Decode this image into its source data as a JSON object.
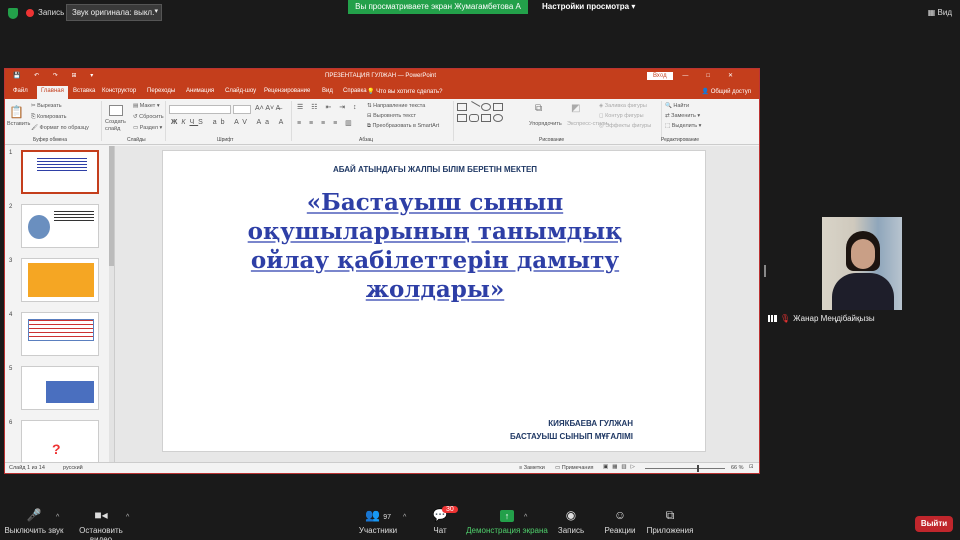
{
  "zoom_top": {
    "record_label": "Запись",
    "audio_label": "Звук оригинала: выкл.",
    "share_banner": "Вы просматриваете экран Жумагамбетова А",
    "view_options": "Настройки просмотра",
    "view_mode": "Вид"
  },
  "ppt": {
    "window_title": "ПРЕЗЕНТАЦИЯ ГУЛЖАН  —  PowerPoint",
    "signin": "Вход",
    "tabs": [
      "Файл",
      "Главная",
      "Вставка",
      "Конструктор",
      "Переходы",
      "Анимация",
      "Слайд-шоу",
      "Рецензирование",
      "Вид",
      "Справка"
    ],
    "tell_me": "Что вы хотите сделать?",
    "share": "Общий доступ",
    "ribbon": {
      "paste": "Вставить",
      "cut": "Вырезать",
      "copy": "Копировать",
      "format_painter": "Формат по образцу",
      "clipboard": "Буфер обмена",
      "new_slide": "Создать слайд",
      "layout": "Макет",
      "reset": "Сбросить",
      "section": "Раздел",
      "slides": "Слайды",
      "font": "Шрифт",
      "text_direction": "Направление текста",
      "align_text": "Выровнять текст",
      "smartart": "Преобразовать в SmartArt",
      "paragraph": "Абзац",
      "arrange": "Упорядочить",
      "quick_styles": "Экспресс-стили",
      "shape_fill": "Заливка фигуры",
      "shape_outline": "Контур фигуры",
      "shape_effects": "Эффекты фигуры",
      "drawing": "Рисование",
      "find": "Найти",
      "replace": "Заменить",
      "select": "Выделить",
      "editing": "Редактирование"
    },
    "slide": {
      "school": "АБАЙ АТЫНДАҒЫ  ЖАЛПЫ БІЛІМ  БЕРЕТІН МЕКТЕП",
      "title_lines": [
        "«Бастауыш сынып",
        "оқушыларының танымдық",
        "ойлау қабілеттерін дамыту",
        "жолдары»"
      ],
      "author_name": "КИЯКБАЕВА ГУЛЖАН",
      "author_role": "БАСТАУЫШ СЫНЫП  МҰҒАЛІМІ"
    },
    "thumbnail_numbers": [
      "1",
      "2",
      "3",
      "4",
      "5",
      "6"
    ],
    "status": {
      "slide_count": "Слайд 1 из 14",
      "language": "русский",
      "notes": "Заметки",
      "comments": "Примечания",
      "zoom": "66 %"
    }
  },
  "participant": {
    "name": "Жанар Меңдібайқызы"
  },
  "zoom_bottom": {
    "mute": "Выключить звук",
    "video": "Остановить видео",
    "participants": "Участники",
    "participants_count": "97",
    "chat": "Чат",
    "chat_badge": "30",
    "share": "Демонстрация экрана",
    "record": "Запись",
    "reactions": "Реакции",
    "apps": "Приложения",
    "leave": "Выйти"
  }
}
